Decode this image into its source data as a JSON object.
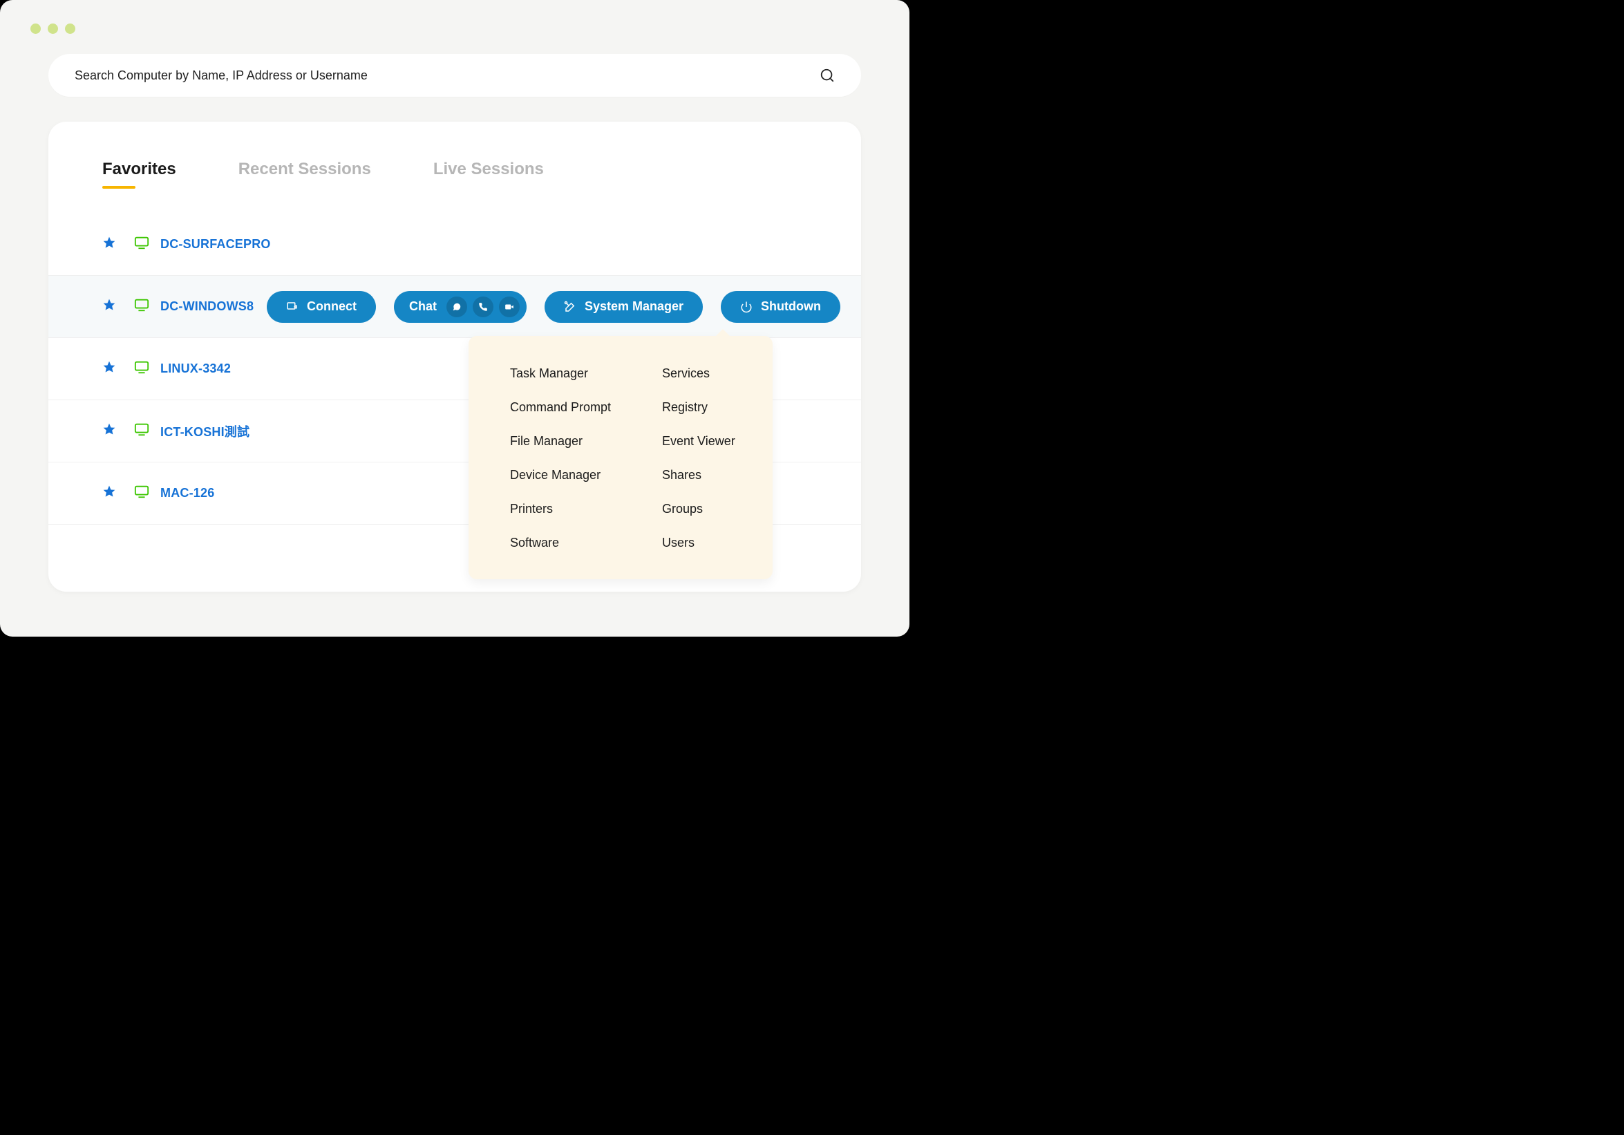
{
  "search": {
    "placeholder": "Search Computer by Name, IP Address or Username"
  },
  "tabs": {
    "0": {
      "label": "Favorites"
    },
    "1": {
      "label": "Recent Sessions"
    },
    "2": {
      "label": "Live Sessions"
    }
  },
  "rows": {
    "0": {
      "name": "DC-SURFACEPRO"
    },
    "1": {
      "name": "DC-WINDOWS8"
    },
    "2": {
      "name": "LINUX-3342"
    },
    "3": {
      "name": "ICT-KOSHI測試"
    },
    "4": {
      "name": "MAC-126"
    }
  },
  "actions": {
    "connect": "Connect",
    "chat": "Chat",
    "system_manager": "System Manager",
    "shutdown": "Shutdown"
  },
  "dropdown": {
    "left": {
      "0": "Task Manager",
      "1": "Command Prompt",
      "2": "File Manager",
      "3": "Device Manager",
      "4": "Printers",
      "5": "Software"
    },
    "right": {
      "0": "Services",
      "1": "Registry",
      "2": "Event Viewer",
      "3": "Shares",
      "4": "Groups",
      "5": "Users"
    }
  }
}
